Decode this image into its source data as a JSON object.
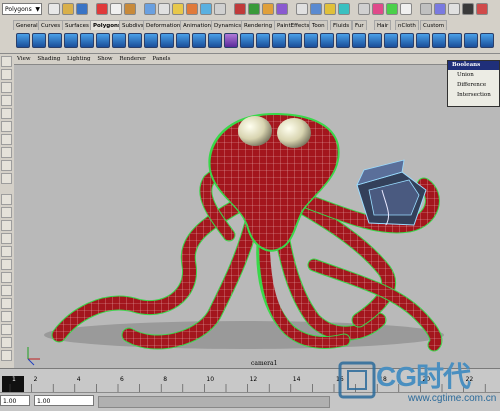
{
  "status_line": {
    "menu_set": "Polygons"
  },
  "shelf_tabs": [
    "General",
    "Curves",
    "Surfaces",
    "Polygons",
    "Subdivs",
    "Deformation",
    "Animation",
    "Dynamics",
    "Rendering",
    "PaintEffects",
    "Toon",
    "Fluids",
    "Fur",
    "Hair",
    "nCloth",
    "Custom"
  ],
  "active_tab": "Polygons",
  "panel_menu": [
    "View",
    "Shading",
    "Lighting",
    "Show",
    "Renderer",
    "Panels"
  ],
  "popup": {
    "title": "Booleans",
    "items": [
      "Union",
      "Difference",
      "Intersection"
    ]
  },
  "viewport": {
    "camera_label": "camera1"
  },
  "timeline": {
    "ticks": [
      "1",
      "2",
      "4",
      "6",
      "8",
      "10",
      "12",
      "14",
      "16",
      "18",
      "20",
      "22"
    ]
  },
  "range": {
    "start": "1.00",
    "current": "1.00"
  },
  "watermark": {
    "brand": "CG时代",
    "site": "www.cgtime.com.cn"
  },
  "colors": {
    "mesh_red": "#a3161d",
    "wire_green": "#39d84a",
    "shelf_blue": "#2f6fc8",
    "popup_header": "#1f2f7a"
  }
}
